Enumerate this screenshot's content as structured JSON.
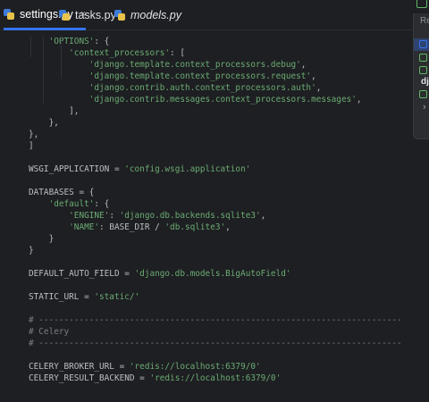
{
  "tabs": [
    {
      "label": "settings.py",
      "italic": false,
      "active": true
    },
    {
      "label": "tasks.py",
      "italic": false,
      "active": false
    },
    {
      "label": "models.py",
      "italic": true,
      "active": false
    }
  ],
  "tab_close_glyph": "×",
  "popup": {
    "title": "Re",
    "framework_label": "dj"
  },
  "code_lines": [
    [
      [
        "    'OPTIONS': {",
        "str-mixed"
      ]
    ],
    [
      [
        "        'context_processors': [",
        "str-mixed"
      ]
    ],
    [
      [
        "            'django.template.context_processors.debug',",
        "str"
      ]
    ],
    [
      [
        "            'django.template.context_processors.request',",
        "str"
      ]
    ],
    [
      [
        "            'django.contrib.auth.context_processors.auth',",
        "str"
      ]
    ],
    [
      [
        "            'django.contrib.messages.context_processors.messages',",
        "str"
      ]
    ],
    [
      [
        "        ],",
        "id"
      ]
    ],
    [
      [
        "    },",
        "id"
      ]
    ],
    [
      [
        "},",
        "id"
      ]
    ],
    [
      [
        "]",
        "id"
      ]
    ],
    [
      [
        "",
        "id"
      ]
    ],
    [
      [
        "WSGI_APPLICATION = 'config.wsgi.application'",
        "assign"
      ]
    ],
    [
      [
        "",
        "id"
      ]
    ],
    [
      [
        "DATABASES = {",
        "id"
      ]
    ],
    [
      [
        "    'default': {",
        "str-mixed"
      ]
    ],
    [
      [
        "        'ENGINE': 'django.db.backends.sqlite3',",
        "str"
      ]
    ],
    [
      [
        "        'NAME': BASE_DIR / 'db.sqlite3',",
        "name-line"
      ]
    ],
    [
      [
        "    }",
        "id"
      ]
    ],
    [
      [
        "}",
        "id"
      ]
    ],
    [
      [
        "",
        "id"
      ]
    ],
    [
      [
        "DEFAULT_AUTO_FIELD = 'django.db.models.BigAutoField'",
        "assign"
      ]
    ],
    [
      [
        "",
        "id"
      ]
    ],
    [
      [
        "STATIC_URL = 'static/'",
        "assign"
      ]
    ],
    [
      [
        "",
        "id"
      ]
    ],
    [
      [
        "# ------------------------------------------------------------------------",
        "com"
      ]
    ],
    [
      [
        "# Celery",
        "com"
      ]
    ],
    [
      [
        "# ------------------------------------------------------------------------",
        "com"
      ]
    ],
    [
      [
        "",
        "id"
      ]
    ],
    [
      [
        "CELERY_BROKER_URL = 'redis://localhost:6379/0'",
        "assign"
      ]
    ],
    [
      [
        "CELERY_RESULT_BACKEND = 'redis://localhost:6379/0'",
        "assign"
      ]
    ]
  ],
  "colors": {
    "background": "#1e1f22",
    "string": "#6aab73",
    "comment": "#7a7e85",
    "text": "#bcbec4",
    "accent": "#3574f0"
  }
}
